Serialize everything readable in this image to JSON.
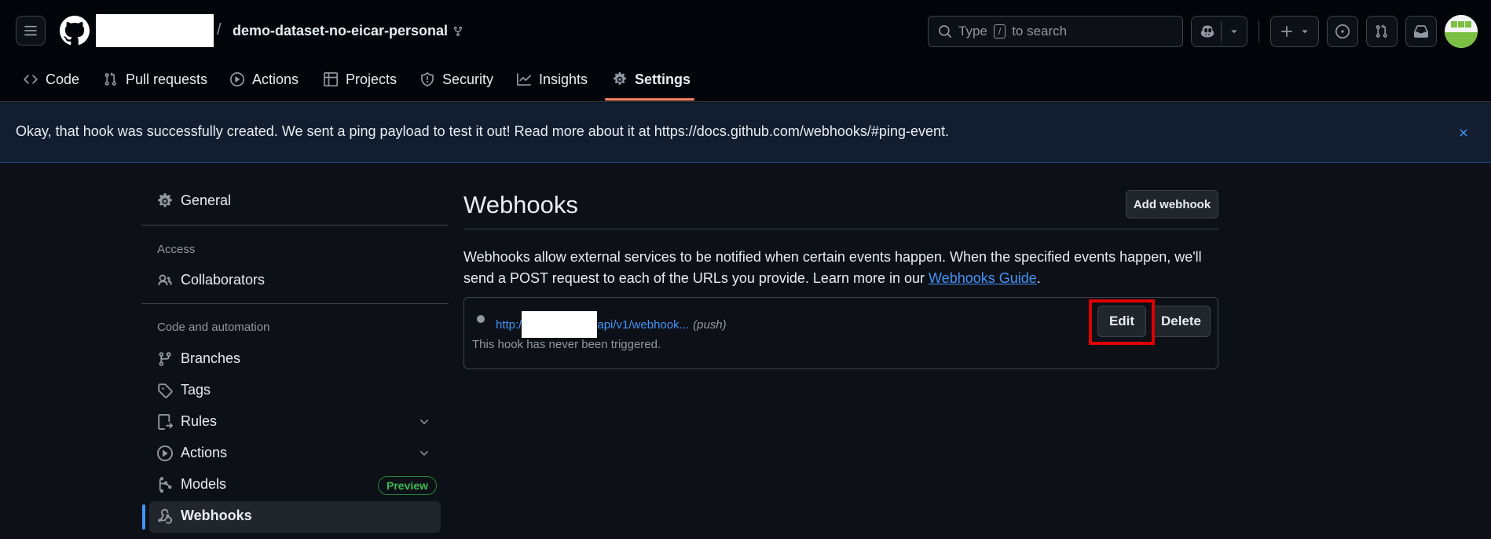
{
  "header": {
    "repo_name": "demo-dataset-no-eicar-personal",
    "separator": "/",
    "search_prefix": "Type",
    "search_key": "/",
    "search_suffix": "to search"
  },
  "tabs": [
    {
      "label": "Code",
      "icon": "code-icon"
    },
    {
      "label": "Pull requests",
      "icon": "git-pull-request-icon"
    },
    {
      "label": "Actions",
      "icon": "play-icon"
    },
    {
      "label": "Projects",
      "icon": "table-icon"
    },
    {
      "label": "Security",
      "icon": "shield-icon"
    },
    {
      "label": "Insights",
      "icon": "graph-icon"
    },
    {
      "label": "Settings",
      "icon": "gear-icon",
      "selected": true
    }
  ],
  "flash": {
    "message": "Okay, that hook was successfully created. We sent a ping payload to test it out! Read more about it at https://docs.github.com/webhooks/#ping-event."
  },
  "sidebar": {
    "general": "General",
    "access_heading": "Access",
    "collaborators": "Collaborators",
    "automation_heading": "Code and automation",
    "items": [
      {
        "label": "Branches",
        "icon": "git-branch-icon"
      },
      {
        "label": "Tags",
        "icon": "tag-icon"
      },
      {
        "label": "Rules",
        "icon": "rule-icon"
      },
      {
        "label": "Actions",
        "icon": "play-icon"
      },
      {
        "label": "Models",
        "icon": "models-icon",
        "badge": "Preview"
      },
      {
        "label": "Webhooks",
        "icon": "webhook-icon",
        "selected": true
      }
    ]
  },
  "main": {
    "title": "Webhooks",
    "add_button": "Add webhook",
    "description": "Webhooks allow external services to be notified when certain events happen. When the specified events happen, we'll send a POST request to each of the URLs you provide. Learn more in our",
    "guide_link": "Webhooks Guide",
    "description_end": ".",
    "hook": {
      "url_prefix": "http:/",
      "url_suffix": "api/v1/webhook...",
      "event": "(push)",
      "status": "This hook has never been triggered.",
      "edit_label": "Edit",
      "delete_label": "Delete"
    }
  },
  "colors": {
    "accent_link": "#4493f8",
    "selected_tab_underline": "#f78166",
    "badge_green": "#3fb950",
    "highlight_box": "#e00000"
  }
}
